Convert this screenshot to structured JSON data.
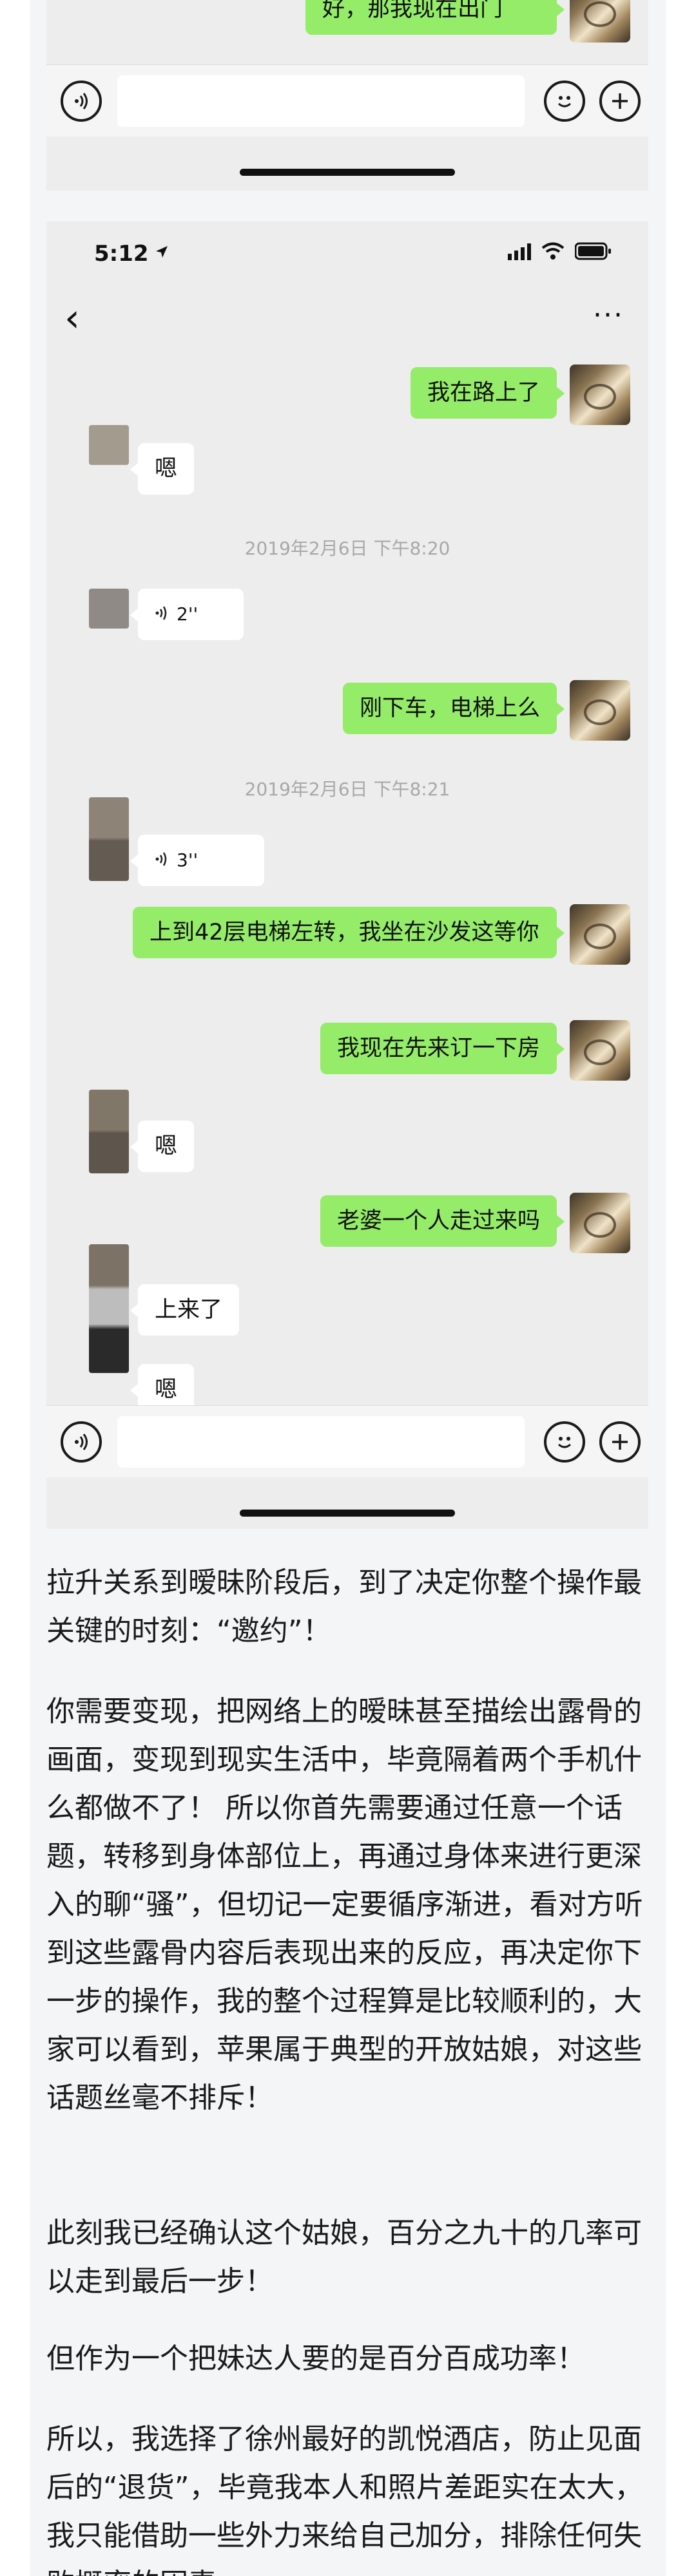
{
  "top_shot": {
    "last_message": "好，那我现在出门"
  },
  "chat": {
    "status_time": "5:12",
    "back_icon": "‹",
    "more_icon": "···",
    "messages": {
      "m1": "我在路上了",
      "m2": "嗯",
      "t1": "2019年2月6日 下午8:20",
      "m3": "2''",
      "m4": "刚下车，电梯上么",
      "t2": "2019年2月6日 下午8:21",
      "m5": "3''",
      "m6": "上到42层电梯左转，我坐在沙发这等你",
      "m7": "我现在先来订一下房",
      "m8": "嗯",
      "m9": "老婆一个人走过来吗",
      "m10": "上来了",
      "m11": "嗯"
    },
    "voice_icon": "voice-icon",
    "emoji_icon": "smile-icon",
    "plus_icon": "plus-icon"
  },
  "article": {
    "p1": "拉升关系到暧昧阶段后，到了决定你整个操作最关键的时刻：“邀约”！",
    "p2": "你需要变现，把网络上的暧昧甚至描绘出露骨的画面，变现到现实生活中，毕竟隔着两个手机什么都做不了！ 所以你首先需要通过任意一个话题，转移到身体部位上，再通过身体来进行更深入的聊“骚”，但切记一定要循序渐进，看对方听到这些露骨内容后表现出来的反应，再决定你下一步的操作，我的整个过程算是比较顺利的，大家可以看到，苹果属于典型的开放姑娘，对这些话题丝毫不排斥！",
    "p3": "此刻我已经确认这个姑娘，百分之九十的几率可以走到最后一步！",
    "p4": "但作为一个把妹达人要的是百分百成功率！",
    "p5": "所以，我选择了徐州最好的凯悦酒店，防止见面后的“退货”，毕竟我本人和照片差距实在太大，我只能借助一些外力来给自己加分，排除任何失败概率的因素。"
  },
  "colors": {
    "bubble_me": "#95ec69",
    "bubble_you": "#ffffff",
    "chat_bg": "#ededed",
    "article_bg": "#f4f5f7"
  }
}
